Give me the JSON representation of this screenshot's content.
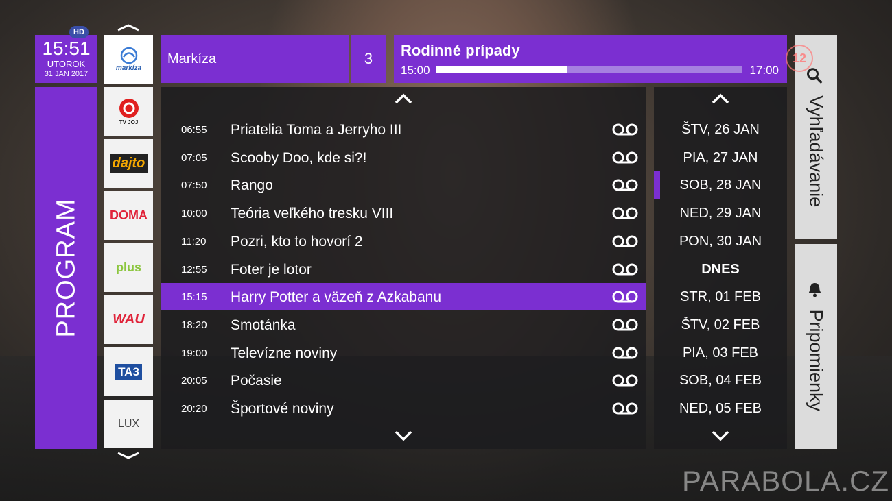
{
  "clock": {
    "time": "15:51",
    "day": "UTOROK",
    "date": "31 JAN 2017",
    "hd_badge": "HD"
  },
  "sidebar": {
    "program_label": "PROGRAM"
  },
  "channels": [
    {
      "name": "markiza",
      "label": "markíza"
    },
    {
      "name": "tvjoj",
      "label": "TV JOJ"
    },
    {
      "name": "dajto",
      "label": "dajto"
    },
    {
      "name": "doma",
      "label": "DOMA"
    },
    {
      "name": "plus",
      "label": "plus"
    },
    {
      "name": "wau",
      "label": "WAU"
    },
    {
      "name": "ta3",
      "label": "TA3"
    },
    {
      "name": "lux",
      "label": "LUX"
    }
  ],
  "header": {
    "channel_name": "Markíza",
    "channel_number": "3",
    "now_title": "Rodinné prípady",
    "now_start": "15:00",
    "now_end": "17:00",
    "progress_fraction": 0.43
  },
  "programs": [
    {
      "time": "06:55",
      "title": "Priatelia Toma a Jerryho III"
    },
    {
      "time": "07:05",
      "title": "Scooby Doo, kde si?!"
    },
    {
      "time": "07:50",
      "title": "Rango"
    },
    {
      "time": "10:00",
      "title": "Teória veľkého tresku VIII"
    },
    {
      "time": "11:20",
      "title": "Pozri, kto to hovorí 2"
    },
    {
      "time": "12:55",
      "title": "Foter je lotor"
    },
    {
      "time": "15:15",
      "title": "Harry Potter a väzeň z Azkabanu"
    },
    {
      "time": "18:20",
      "title": "Smotánka"
    },
    {
      "time": "19:00",
      "title": "Televízne noviny"
    },
    {
      "time": "20:05",
      "title": "Počasie"
    },
    {
      "time": "20:20",
      "title": "Športové noviny"
    }
  ],
  "selected_program": 6,
  "dates": [
    "ŠTV, 26 JAN",
    "PIA, 27 JAN",
    "SOB, 28 JAN",
    "NED, 29 JAN",
    "PON, 30 JAN",
    "DNES",
    "STR, 01 FEB",
    "ŠTV, 02 FEB",
    "PIA, 03 FEB",
    "SOB, 04 FEB",
    "NED, 05 FEB"
  ],
  "marked_date": 2,
  "today_date": 5,
  "side": {
    "search_label": "Vyhľadávanie",
    "remind_label": "Pripomienky"
  },
  "age_rating": "12",
  "watermark": "PARABOLA.CZ",
  "colors": {
    "accent": "#7b2fd1"
  },
  "icons": {
    "record": "record-icon",
    "search": "search-icon",
    "bell": "bell-icon",
    "up": "chevron-up-icon",
    "down": "chevron-down-icon"
  }
}
